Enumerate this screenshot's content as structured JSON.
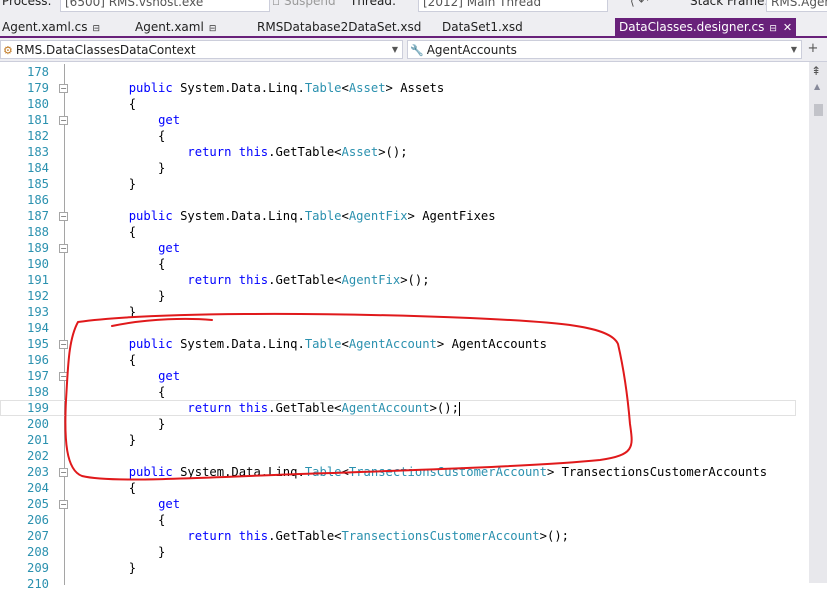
{
  "debug_toolbar": {
    "process_label": "Process:",
    "process_value": "[6500] RMS.vshost.exe",
    "suspend_label": "Suspend",
    "thread_label": "Thread:",
    "thread_value": "[2012] Main Thread",
    "stack_frame_label": "Stack Frame:",
    "stack_frame_value": "RMS.Agen"
  },
  "tabs": [
    {
      "label": "Agent.xaml.cs",
      "pinned": true,
      "active": false
    },
    {
      "label": "Agent.xaml",
      "pinned": true,
      "active": false
    },
    {
      "label": "RMSDatabase2DataSet.xsd",
      "pinned": false,
      "active": false
    },
    {
      "label": "DataSet1.xsd",
      "pinned": false,
      "active": false
    },
    {
      "label": "DataClasses.designer.cs",
      "pinned": true,
      "active": true
    }
  ],
  "icons": {
    "pin": "pin-icon",
    "close": "close-icon",
    "class": "class-icon",
    "property": "wrench-icon"
  },
  "navbar": {
    "type_selector": "RMS.DataClassesDataContext",
    "member_selector": "AgentAccounts"
  },
  "colors": {
    "active_tab": "#68217a",
    "keyword": "#0000ff",
    "type_name": "#2b91af",
    "line_number": "#2b91af",
    "annotation": "#e0191b"
  },
  "code_lines": [
    {
      "num": "178",
      "fold": "",
      "tokens": []
    },
    {
      "num": "179",
      "fold": "minus",
      "tokens": [
        [
          "",
          "        "
        ],
        [
          "kw",
          "public"
        ],
        [
          "",
          " System.Data.Linq."
        ],
        [
          "ty",
          "Table"
        ],
        [
          "",
          "<"
        ],
        [
          "ty",
          "Asset"
        ],
        [
          "",
          "> Assets"
        ]
      ]
    },
    {
      "num": "180",
      "fold": "",
      "tokens": [
        [
          "",
          "        {"
        ]
      ]
    },
    {
      "num": "181",
      "fold": "minus",
      "tokens": [
        [
          "",
          "            "
        ],
        [
          "kw",
          "get"
        ]
      ]
    },
    {
      "num": "182",
      "fold": "",
      "tokens": [
        [
          "",
          "            {"
        ]
      ]
    },
    {
      "num": "183",
      "fold": "",
      "tokens": [
        [
          "",
          "                "
        ],
        [
          "kw",
          "return"
        ],
        [
          "",
          " "
        ],
        [
          "kw",
          "this"
        ],
        [
          "",
          ".GetTable<"
        ],
        [
          "ty",
          "Asset"
        ],
        [
          "",
          ">();"
        ]
      ]
    },
    {
      "num": "184",
      "fold": "",
      "tokens": [
        [
          "",
          "            }"
        ]
      ]
    },
    {
      "num": "185",
      "fold": "",
      "tokens": [
        [
          "",
          "        }"
        ]
      ]
    },
    {
      "num": "186",
      "fold": "",
      "tokens": []
    },
    {
      "num": "187",
      "fold": "minus",
      "tokens": [
        [
          "",
          "        "
        ],
        [
          "kw",
          "public"
        ],
        [
          "",
          " System.Data.Linq."
        ],
        [
          "ty",
          "Table"
        ],
        [
          "",
          "<"
        ],
        [
          "ty",
          "AgentFix"
        ],
        [
          "",
          "> AgentFixes"
        ]
      ]
    },
    {
      "num": "188",
      "fold": "",
      "tokens": [
        [
          "",
          "        {"
        ]
      ]
    },
    {
      "num": "189",
      "fold": "minus",
      "tokens": [
        [
          "",
          "            "
        ],
        [
          "kw",
          "get"
        ]
      ]
    },
    {
      "num": "190",
      "fold": "",
      "tokens": [
        [
          "",
          "            {"
        ]
      ]
    },
    {
      "num": "191",
      "fold": "",
      "tokens": [
        [
          "",
          "                "
        ],
        [
          "kw",
          "return"
        ],
        [
          "",
          " "
        ],
        [
          "kw",
          "this"
        ],
        [
          "",
          ".GetTable<"
        ],
        [
          "ty",
          "AgentFix"
        ],
        [
          "",
          ">();"
        ]
      ]
    },
    {
      "num": "192",
      "fold": "",
      "tokens": [
        [
          "",
          "            }"
        ]
      ]
    },
    {
      "num": "193",
      "fold": "",
      "tokens": [
        [
          "",
          "        }"
        ]
      ]
    },
    {
      "num": "194",
      "fold": "",
      "tokens": []
    },
    {
      "num": "195",
      "fold": "minus",
      "tokens": [
        [
          "",
          "        "
        ],
        [
          "kw",
          "public"
        ],
        [
          "",
          " System.Data.Linq."
        ],
        [
          "ty",
          "Table"
        ],
        [
          "",
          "<"
        ],
        [
          "ty",
          "AgentAccount"
        ],
        [
          "",
          "> AgentAccounts"
        ]
      ]
    },
    {
      "num": "196",
      "fold": "",
      "tokens": [
        [
          "",
          "        {"
        ]
      ]
    },
    {
      "num": "197",
      "fold": "minus",
      "tokens": [
        [
          "",
          "            "
        ],
        [
          "kw",
          "get"
        ]
      ]
    },
    {
      "num": "198",
      "fold": "",
      "tokens": [
        [
          "",
          "            {"
        ]
      ]
    },
    {
      "num": "199",
      "fold": "",
      "current": true,
      "tokens": [
        [
          "",
          "                "
        ],
        [
          "kw",
          "return"
        ],
        [
          "",
          " "
        ],
        [
          "kw",
          "this"
        ],
        [
          "",
          ".GetTable<"
        ],
        [
          "ty",
          "AgentAccount"
        ],
        [
          "",
          ">();"
        ]
      ]
    },
    {
      "num": "200",
      "fold": "",
      "tokens": [
        [
          "",
          "            }"
        ]
      ]
    },
    {
      "num": "201",
      "fold": "",
      "tokens": [
        [
          "",
          "        }"
        ]
      ]
    },
    {
      "num": "202",
      "fold": "",
      "tokens": []
    },
    {
      "num": "203",
      "fold": "minus",
      "tokens": [
        [
          "",
          "        "
        ],
        [
          "kw",
          "public"
        ],
        [
          "",
          " System.Data.Linq."
        ],
        [
          "ty",
          "Table"
        ],
        [
          "",
          "<"
        ],
        [
          "ty",
          "TransectionsCustomerAccount"
        ],
        [
          "",
          "> TransectionsCustomerAccounts"
        ]
      ]
    },
    {
      "num": "204",
      "fold": "",
      "tokens": [
        [
          "",
          "        {"
        ]
      ]
    },
    {
      "num": "205",
      "fold": "minus",
      "tokens": [
        [
          "",
          "            "
        ],
        [
          "kw",
          "get"
        ]
      ]
    },
    {
      "num": "206",
      "fold": "",
      "tokens": [
        [
          "",
          "            {"
        ]
      ]
    },
    {
      "num": "207",
      "fold": "",
      "tokens": [
        [
          "",
          "                "
        ],
        [
          "kw",
          "return"
        ],
        [
          "",
          " "
        ],
        [
          "kw",
          "this"
        ],
        [
          "",
          ".GetTable<"
        ],
        [
          "ty",
          "TransectionsCustomerAccount"
        ],
        [
          "",
          ">();"
        ]
      ]
    },
    {
      "num": "208",
      "fold": "",
      "tokens": [
        [
          "",
          "            }"
        ]
      ]
    },
    {
      "num": "209",
      "fold": "",
      "tokens": [
        [
          "",
          "        }"
        ]
      ]
    },
    {
      "num": "210",
      "fold": "",
      "tokens": []
    }
  ]
}
